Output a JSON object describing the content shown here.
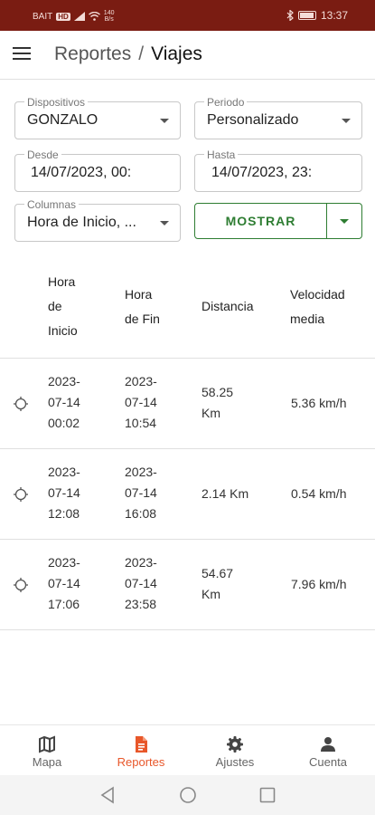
{
  "status_bar": {
    "carrier": "BAIT",
    "network_badge": "HD",
    "speed_top": "140",
    "speed_bottom": "B/s",
    "time": "13:37"
  },
  "header": {
    "menu_icon": "hamburger-menu-icon",
    "breadcrumb_parent": "Reportes",
    "separator": "/",
    "breadcrumb_current": "Viajes"
  },
  "filters": {
    "devices": {
      "label": "Dispositivos",
      "value": "GONZALO"
    },
    "period": {
      "label": "Periodo",
      "value": "Personalizado"
    },
    "from": {
      "label": "Desde",
      "value": "14/07/2023, 00:"
    },
    "to": {
      "label": "Hasta",
      "value": "14/07/2023, 23:"
    },
    "columns": {
      "label": "Columnas",
      "value": "Hora de Inicio, ..."
    },
    "show_button": "MOSTRAR"
  },
  "table": {
    "headers": {
      "start": [
        "Hora",
        "de",
        "Inicio"
      ],
      "end": [
        "Hora",
        "de Fin"
      ],
      "distance": [
        "Distancia"
      ],
      "speed": [
        "Velocidad",
        "media"
      ]
    },
    "rows": [
      {
        "start": [
          "2023-",
          "07-14",
          "00:02"
        ],
        "end": [
          "2023-",
          "07-14",
          "10:54"
        ],
        "distance": [
          "58.25",
          "Km"
        ],
        "speed": [
          "5.36 km/h"
        ]
      },
      {
        "start": [
          "2023-",
          "07-14",
          "12:08"
        ],
        "end": [
          "2023-",
          "07-14",
          "16:08"
        ],
        "distance": [
          "2.14 Km"
        ],
        "speed": [
          "0.54 km/h"
        ]
      },
      {
        "start": [
          "2023-",
          "07-14",
          "17:06"
        ],
        "end": [
          "2023-",
          "07-14",
          "23:58"
        ],
        "distance": [
          "54.67",
          "Km"
        ],
        "speed": [
          "7.96 km/h"
        ]
      }
    ]
  },
  "bottom_nav": {
    "items": [
      {
        "label": "Mapa",
        "icon": "map-icon"
      },
      {
        "label": "Reportes",
        "icon": "report-document-icon"
      },
      {
        "label": "Ajustes",
        "icon": "settings-gear-icon"
      },
      {
        "label": "Cuenta",
        "icon": "account-person-icon"
      }
    ],
    "active_index": 1
  },
  "colors": {
    "status_bar": "#7a1c12",
    "accent": "#e8572a",
    "show_button": "#2e7d32"
  }
}
